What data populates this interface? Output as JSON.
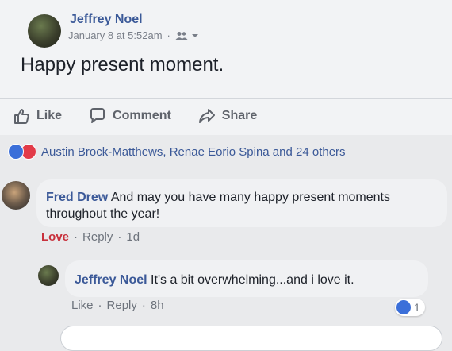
{
  "post": {
    "author": "Jeffrey Noel",
    "timestamp": "January 8 at 5:52am",
    "privacy_icon": "friends-icon",
    "text": "Happy present moment."
  },
  "actions": {
    "like": "Like",
    "comment": "Comment",
    "share": "Share"
  },
  "reactions": {
    "names": "Austin Brock-Matthews, Renae Eorio Spina and 24 others"
  },
  "comments": [
    {
      "author": "Fred Drew",
      "text_line1": "And may you have many happy present moments",
      "text_line2": "throughout the year!",
      "links": {
        "love": "Love",
        "reply": "Reply",
        "time": "1d"
      }
    }
  ],
  "replies": [
    {
      "author": "Jeffrey Noel",
      "text": "It's a bit overwhelming...and i love it.",
      "links": {
        "like": "Like",
        "reply": "Reply",
        "time": "8h"
      },
      "like_count": "1"
    }
  ],
  "colors": {
    "link_blue": "#3b5998",
    "like_blue": "#3b6fd9",
    "love_red": "#e23b48"
  }
}
